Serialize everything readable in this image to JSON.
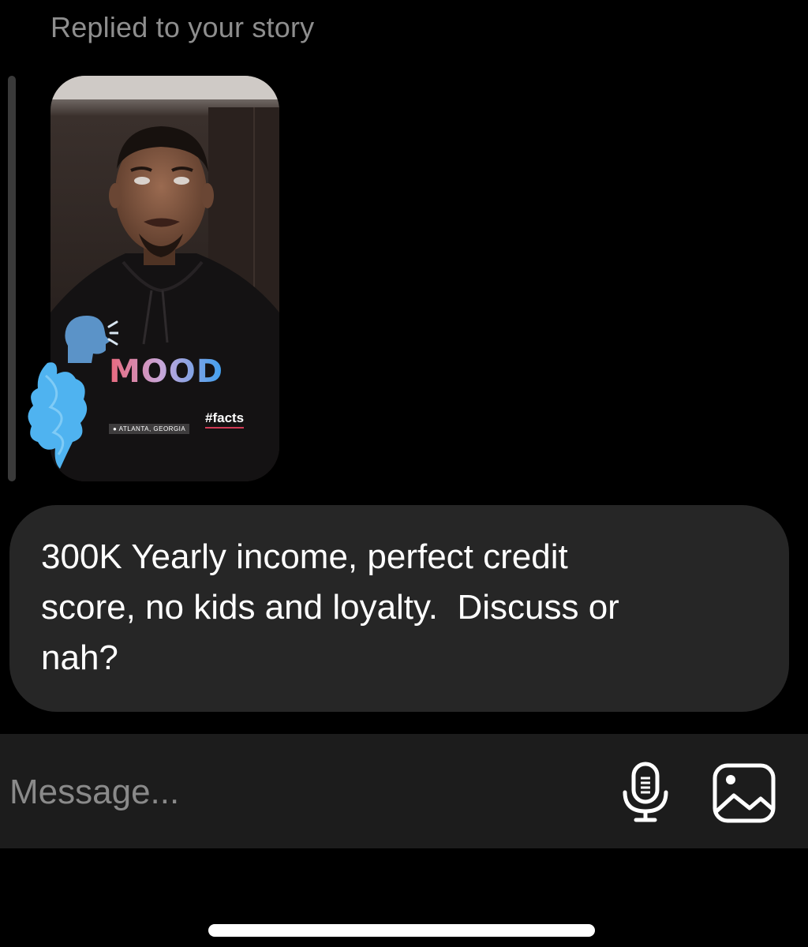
{
  "reply_caption": "Replied to your story",
  "story": {
    "sticker_mood": "MOOD",
    "hashtag": "#facts",
    "location": "ATLANTA, GEORGIA",
    "icons": [
      "speaking-head-icon",
      "location-pin-icon"
    ]
  },
  "message": {
    "text": "300K Yearly income, perfect credit\nscore, no kids and loyalty.  Discuss or\nnah?"
  },
  "composer": {
    "placeholder": "Message...",
    "icons": [
      "microphone-icon",
      "image-icon"
    ]
  },
  "colors": {
    "background": "#000000",
    "bubble": "#262626",
    "composer": "#1c1c1c",
    "caption": "#8e8e8e",
    "scribble": "#4fb3f0"
  }
}
